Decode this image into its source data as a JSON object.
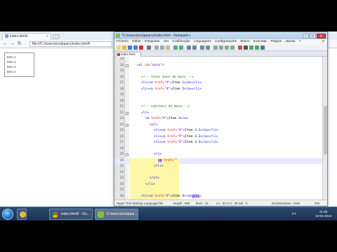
{
  "browser": {
    "tab_title": "index.html#",
    "address": "file:///C:/exercicios/jquery/index.html#",
    "list_items": [
      "Item 1",
      "Item 2",
      "Item 3",
      "Item 4"
    ]
  },
  "editor_window": {
    "title": "*C:\\exercicios\\jquery\\index.html - Notepad++",
    "menus": [
      "Ficheiro",
      "Editar",
      "Pesquisar",
      "Ver",
      "Codificação",
      "Linguagens",
      "Configurações",
      "Macro",
      "Executar",
      "Plugins",
      "Janela",
      "?"
    ],
    "menu_close": "X",
    "doc_tab": "index.html",
    "window_buttons": [
      "–",
      "□",
      "✕"
    ]
  },
  "code_lines": [
    {
      "n": "13",
      "text": ""
    },
    {
      "n": "14",
      "text": "<ul id=\"menu\">"
    },
    {
      "n": "15",
      "text": ""
    },
    {
      "n": "16",
      "text": "<!-- itens base do menu -->"
    },
    {
      "n": "17",
      "text": "<li><a href=\"#\">Item 1</a></li>"
    },
    {
      "n": "18",
      "text": "<li><a href=\"#\">Item 2</a></li>"
    },
    {
      "n": "19",
      "text": ""
    },
    {
      "n": "20",
      "text": ""
    },
    {
      "n": "21",
      "text": "<!-- subitens do menu -->"
    },
    {
      "n": "22",
      "text": "<li>"
    },
    {
      "n": "23",
      "text": "<a href=\"#\">Item 3</a>"
    },
    {
      "n": "24",
      "text": "<ul>"
    },
    {
      "n": "25",
      "text": "<li><a href=\"#\">Item 3.1</a></li>"
    },
    {
      "n": "26",
      "text": "<li><a href=\"#\">Item 3.2</a></li>"
    },
    {
      "n": "27",
      "text": "<li><a href=\"#\">Item 3.3</a></li>"
    },
    {
      "n": "28",
      "text": ""
    },
    {
      "n": "29",
      "text": "<li>"
    },
    {
      "n": "30",
      "text": "<a href=\"\""
    },
    {
      "n": "31",
      "text": "</li>"
    },
    {
      "n": "32",
      "text": ""
    },
    {
      "n": "33",
      "text": "</ul>"
    },
    {
      "n": "34",
      "text": "</li>"
    },
    {
      "n": "35",
      "text": ""
    },
    {
      "n": "36",
      "text": "<li><a href=\"#\">Item 4</a></li>"
    },
    {
      "n": "37",
      "text": ""
    }
  ],
  "status": {
    "type": "Hyper Text Markup Language file",
    "length": "length : 888",
    "lines": "lines : 41",
    "position": "Ln : 30   Col : 38   Sel : 0",
    "eol": "Dos\\Windows",
    "encoding": "ANSI",
    "mode": "INS"
  },
  "taskbar": {
    "items": [
      "index.html# - Go...",
      "C:\\exercicios\\jque..."
    ],
    "lang": "PT",
    "time": "21:09",
    "date": "12-02-2013"
  },
  "colors": {
    "tag": "#0000ff",
    "attr": "#ff0000",
    "string": "#8000ff",
    "comment": "#008000",
    "selection": "#c5a3f0",
    "current_line": "#e8e8ff",
    "fold_band": "#fff7a8"
  }
}
